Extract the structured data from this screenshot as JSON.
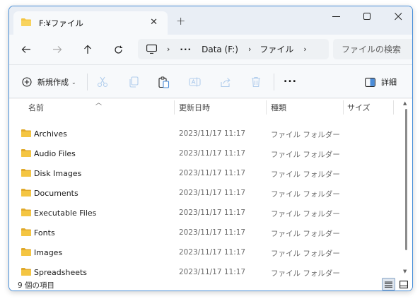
{
  "window": {
    "tab_title": "F:¥ファイル",
    "minimize_icon": "minimize-icon",
    "maximize_icon": "maximize-icon",
    "close_icon": "close-icon"
  },
  "address": {
    "crumbs": [
      "Data (F:)",
      "ファイル"
    ],
    "search_placeholder": "ファイルの検索",
    "overflow": "···"
  },
  "commandbar": {
    "new_label": "新規作成",
    "details_label": "詳細",
    "more": "..."
  },
  "columns": {
    "name": "名前",
    "date": "更新日時",
    "type": "種類",
    "size": "サイズ"
  },
  "rows": [
    {
      "name": "Archives",
      "date": "2023/11/17 11:17",
      "type": "ファイル フォルダー"
    },
    {
      "name": "Audio Files",
      "date": "2023/11/17 11:17",
      "type": "ファイル フォルダー"
    },
    {
      "name": "Disk Images",
      "date": "2023/11/17 11:17",
      "type": "ファイル フォルダー"
    },
    {
      "name": "Documents",
      "date": "2023/11/17 11:17",
      "type": "ファイル フォルダー"
    },
    {
      "name": "Executable Files",
      "date": "2023/11/17 11:17",
      "type": "ファイル フォルダー"
    },
    {
      "name": "Fonts",
      "date": "2023/11/17 11:17",
      "type": "ファイル フォルダー"
    },
    {
      "name": "Images",
      "date": "2023/11/17 11:17",
      "type": "ファイル フォルダー"
    },
    {
      "name": "Spreadsheets",
      "date": "2023/11/17 11:17",
      "type": "ファイル フォルダー"
    }
  ],
  "status": {
    "count_text": "9 個の項目"
  },
  "colors": {
    "accent": "#4a90d9",
    "folder": "#f4c542",
    "folder_dark": "#e0a92b"
  }
}
